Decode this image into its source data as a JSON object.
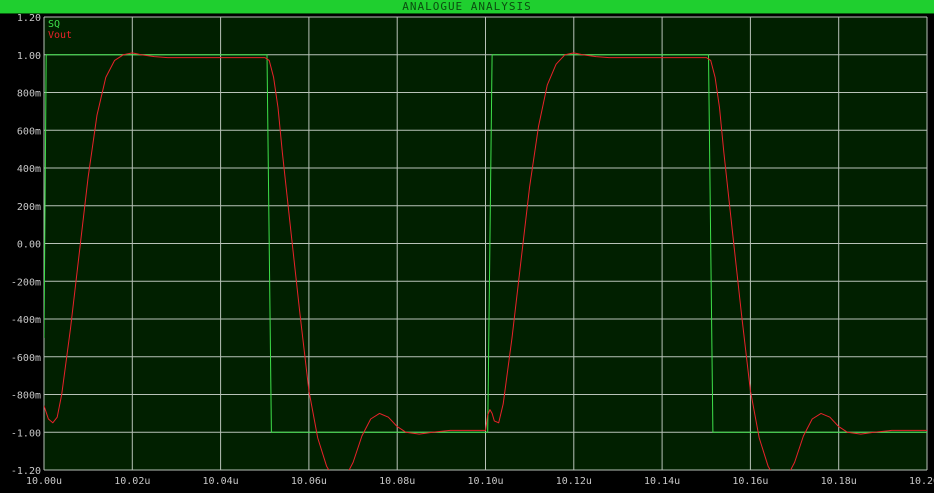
{
  "window": {
    "title": "ANALOGUE ANALYSIS"
  },
  "colors": {
    "plot_bg": "#012000",
    "grid": "#b8c2b8",
    "axis_text": "#c8c8c8",
    "sq_trace": "#3ee04a",
    "vout_trace": "#e8222a",
    "title_bar": "#1fcf2f"
  },
  "chart_data": {
    "type": "line",
    "title": "",
    "xlabel": "",
    "ylabel": "",
    "xlim": [
      10.0,
      10.2
    ],
    "ylim": [
      -1.2,
      1.2
    ],
    "x_unit": "u",
    "grid": true,
    "legend_position": "top-left",
    "x_ticks": [
      {
        "value": 10.0,
        "label": "10.00u"
      },
      {
        "value": 10.02,
        "label": "10.02u"
      },
      {
        "value": 10.04,
        "label": "10.04u"
      },
      {
        "value": 10.06,
        "label": "10.06u"
      },
      {
        "value": 10.08,
        "label": "10.08u"
      },
      {
        "value": 10.1,
        "label": "10.10u"
      },
      {
        "value": 10.12,
        "label": "10.12u"
      },
      {
        "value": 10.14,
        "label": "10.14u"
      },
      {
        "value": 10.16,
        "label": "10.16u"
      },
      {
        "value": 10.18,
        "label": "10.18u"
      },
      {
        "value": 10.2,
        "label": "10.20u"
      }
    ],
    "y_ticks": [
      {
        "value": 1.2,
        "label": "1.20"
      },
      {
        "value": 1.0,
        "label": "1.00"
      },
      {
        "value": 0.8,
        "label": "800m"
      },
      {
        "value": 0.6,
        "label": "600m"
      },
      {
        "value": 0.4,
        "label": "400m"
      },
      {
        "value": 0.2,
        "label": "200m"
      },
      {
        "value": 0.0,
        "label": "0.00"
      },
      {
        "value": -0.2,
        "label": "-200m"
      },
      {
        "value": -0.4,
        "label": "-400m"
      },
      {
        "value": -0.6,
        "label": "-600m"
      },
      {
        "value": -0.8,
        "label": "-800m"
      },
      {
        "value": -1.0,
        "label": "-1.00"
      },
      {
        "value": -1.2,
        "label": "-1.20"
      }
    ],
    "series": [
      {
        "name": "SQ",
        "color": "#3ee04a",
        "points": [
          [
            10.0,
            -0.5
          ],
          [
            10.0005,
            1.0
          ],
          [
            10.0505,
            1.0
          ],
          [
            10.0515,
            -1.0
          ],
          [
            10.1005,
            -1.0
          ],
          [
            10.1015,
            1.0
          ],
          [
            10.1505,
            1.0
          ],
          [
            10.1515,
            -1.0
          ],
          [
            10.2,
            -1.0
          ]
        ]
      },
      {
        "name": "Vout",
        "color": "#e8222a",
        "points": [
          [
            10.0,
            -0.86
          ],
          [
            10.001,
            -0.93
          ],
          [
            10.002,
            -0.95
          ],
          [
            10.003,
            -0.92
          ],
          [
            10.004,
            -0.8
          ],
          [
            10.006,
            -0.45
          ],
          [
            10.008,
            -0.05
          ],
          [
            10.01,
            0.35
          ],
          [
            10.012,
            0.68
          ],
          [
            10.014,
            0.88
          ],
          [
            10.016,
            0.97
          ],
          [
            10.018,
            1.0
          ],
          [
            10.02,
            1.01
          ],
          [
            10.022,
            1.0
          ],
          [
            10.025,
            0.99
          ],
          [
            10.028,
            0.985
          ],
          [
            10.032,
            0.985
          ],
          [
            10.04,
            0.985
          ],
          [
            10.05,
            0.985
          ],
          [
            10.051,
            0.97
          ],
          [
            10.052,
            0.88
          ],
          [
            10.053,
            0.72
          ],
          [
            10.054,
            0.48
          ],
          [
            10.056,
            0.05
          ],
          [
            10.058,
            -0.38
          ],
          [
            10.06,
            -0.78
          ],
          [
            10.062,
            -1.03
          ],
          [
            10.064,
            -1.18
          ],
          [
            10.066,
            -1.26
          ],
          [
            10.068,
            -1.25
          ],
          [
            10.07,
            -1.16
          ],
          [
            10.072,
            -1.02
          ],
          [
            10.074,
            -0.93
          ],
          [
            10.076,
            -0.9
          ],
          [
            10.078,
            -0.92
          ],
          [
            10.08,
            -0.97
          ],
          [
            10.082,
            -1.0
          ],
          [
            10.085,
            -1.01
          ],
          [
            10.088,
            -1.0
          ],
          [
            10.092,
            -0.99
          ],
          [
            10.1,
            -0.99
          ],
          [
            10.1005,
            -0.91
          ],
          [
            10.101,
            -0.88
          ],
          [
            10.1015,
            -0.9
          ],
          [
            10.102,
            -0.94
          ],
          [
            10.103,
            -0.95
          ],
          [
            10.104,
            -0.85
          ],
          [
            10.106,
            -0.5
          ],
          [
            10.108,
            -0.1
          ],
          [
            10.11,
            0.3
          ],
          [
            10.112,
            0.62
          ],
          [
            10.114,
            0.84
          ],
          [
            10.116,
            0.95
          ],
          [
            10.118,
            1.0
          ],
          [
            10.12,
            1.01
          ],
          [
            10.122,
            1.0
          ],
          [
            10.125,
            0.99
          ],
          [
            10.128,
            0.985
          ],
          [
            10.14,
            0.985
          ],
          [
            10.15,
            0.985
          ],
          [
            10.151,
            0.97
          ],
          [
            10.152,
            0.88
          ],
          [
            10.153,
            0.72
          ],
          [
            10.154,
            0.48
          ],
          [
            10.156,
            0.05
          ],
          [
            10.158,
            -0.38
          ],
          [
            10.16,
            -0.78
          ],
          [
            10.162,
            -1.03
          ],
          [
            10.164,
            -1.18
          ],
          [
            10.166,
            -1.26
          ],
          [
            10.168,
            -1.25
          ],
          [
            10.17,
            -1.16
          ],
          [
            10.172,
            -1.02
          ],
          [
            10.174,
            -0.93
          ],
          [
            10.176,
            -0.9
          ],
          [
            10.178,
            -0.92
          ],
          [
            10.18,
            -0.97
          ],
          [
            10.182,
            -1.0
          ],
          [
            10.185,
            -1.01
          ],
          [
            10.188,
            -1.0
          ],
          [
            10.192,
            -0.99
          ],
          [
            10.2,
            -0.99
          ]
        ]
      }
    ]
  }
}
